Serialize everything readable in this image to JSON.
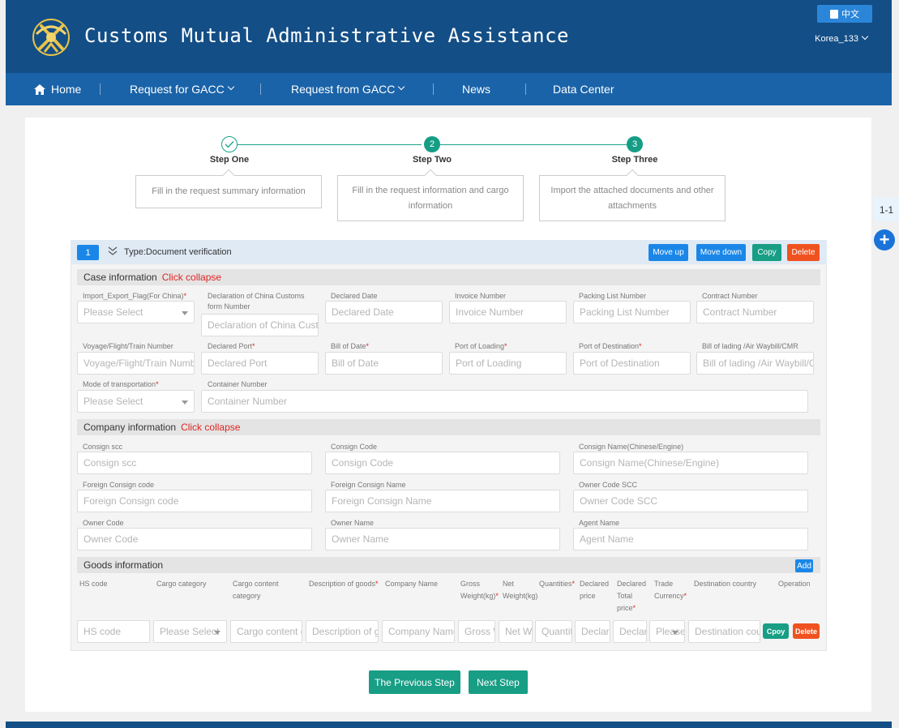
{
  "header": {
    "site_title": "Customs Mutual Administrative Assistance",
    "language_label": "中文",
    "user_label": "Korea_133"
  },
  "nav": {
    "home": "Home",
    "request_for": "Request for GACC",
    "request_from": "Request from GACC",
    "news": "News",
    "data_center": "Data Center"
  },
  "steps": [
    {
      "label": "Step One",
      "number": "",
      "description": "Fill in the request summary information"
    },
    {
      "label": "Step Two",
      "number": "2",
      "description": "Fill in the request information and cargo information"
    },
    {
      "label": "Step Three",
      "number": "3",
      "description": "Import the attached documents and other attachments"
    }
  ],
  "side": {
    "page_indicator": "1-1",
    "add_symbol": "+"
  },
  "panel": {
    "index": "1",
    "type_label": "Type:Document verification",
    "buttons": {
      "move_up": "Move up",
      "move_down": "Move down",
      "copy": "Copy",
      "delete": "Delete"
    }
  },
  "case": {
    "title": "Case information",
    "collapse": "Click collapse",
    "fields": {
      "import_export_flag": {
        "label": "Import_Export_Flag(For China)",
        "placeholder": "Please Select"
      },
      "declaration_form": {
        "label": "Declaration of China Customs form Number",
        "placeholder": "Declaration of China Customs"
      },
      "declared_date": {
        "label": "Declared Date",
        "placeholder": "Declared Date"
      },
      "invoice_number": {
        "label": "Invoice Number",
        "placeholder": "Invoice Number"
      },
      "packing_list": {
        "label": "Packing List Number",
        "placeholder": "Packing List Number"
      },
      "contract_number": {
        "label": "Contract Number",
        "placeholder": "Contract Number"
      },
      "voyage": {
        "label": "Voyage/Flight/Train Number",
        "placeholder": "Voyage/Flight/Train Number"
      },
      "declared_port": {
        "label": "Declared Port",
        "placeholder": "Declared Port"
      },
      "bill_of_date": {
        "label": "Bill of Date",
        "placeholder": "Bill of Date"
      },
      "port_of_loading": {
        "label": "Port of Loading",
        "placeholder": "Port of Loading"
      },
      "port_of_destination": {
        "label": "Port of Destination",
        "placeholder": "Port of Destination"
      },
      "bill_of_lading": {
        "label": "Bill of lading /Air Waybill/CMR",
        "placeholder": "Bill of lading /Air Waybill/CMR"
      },
      "mode_of_transport": {
        "label": "Mode of transportation",
        "placeholder": "Please Select"
      },
      "container_number": {
        "label": "Container Number",
        "placeholder": "Container Number"
      }
    }
  },
  "company": {
    "title": "Company information",
    "collapse": "Click collapse",
    "fields": {
      "consign_scc": {
        "label": "Consign scc",
        "placeholder": "Consign scc"
      },
      "consign_code": {
        "label": "Consign Code",
        "placeholder": "Consign Code"
      },
      "consign_name": {
        "label": "Consign Name(Chinese/Engine)",
        "placeholder": "Consign Name(Chinese/Engine)"
      },
      "foreign_consign_code": {
        "label": "Foreign Consign code",
        "placeholder": "Foreign Consign code"
      },
      "foreign_consign_name": {
        "label": "Foreign Consign Name",
        "placeholder": "Foreign Consign Name"
      },
      "owner_code_scc": {
        "label": "Owner Code SCC",
        "placeholder": "Owner Code SCC"
      },
      "owner_code": {
        "label": "Owner Code",
        "placeholder": "Owner Code"
      },
      "owner_name": {
        "label": "Owner Name",
        "placeholder": "Owner Name"
      },
      "agent_name": {
        "label": "Agent Name",
        "placeholder": "Agent Name"
      }
    }
  },
  "goods": {
    "title": "Goods information",
    "add": "Add",
    "columns": {
      "hs_code": "HS code",
      "cargo_category": "Cargo category",
      "cargo_content": "Cargo content category",
      "description": "Description of goods",
      "company_name": "Company Name",
      "gross_weight": "Gross Weight(kg)",
      "net_weight": "Net Weight(kg)",
      "quantities": "Quantities",
      "declared_price": "Declared price",
      "declared_total": "Declared Total price",
      "trade_currency": "Trade Currency",
      "destination_country": "Destination country",
      "operation": "Operation"
    },
    "row": {
      "hs_code": "HS code",
      "cargo_category": "Please Select",
      "cargo_content": "Cargo content category",
      "description": "Description of goods",
      "company_name": "Company Name",
      "gross_weight": "Gross Weight",
      "net_weight": "Net Weight",
      "quantities": "Quantities",
      "declared_price": "Declared price",
      "declared_total": "Declared Total",
      "trade_currency": "Please",
      "destination_country": "Destination country",
      "copy": "Cpoy",
      "delete": "Delete"
    }
  },
  "footer": {
    "previous": "The Previous Step",
    "next": "Next Step"
  },
  "colors": {
    "header": "#134e86",
    "nav": "#1a63a8",
    "primary": "#1a87e8",
    "teal": "#179e85",
    "danger": "#f0521f"
  }
}
